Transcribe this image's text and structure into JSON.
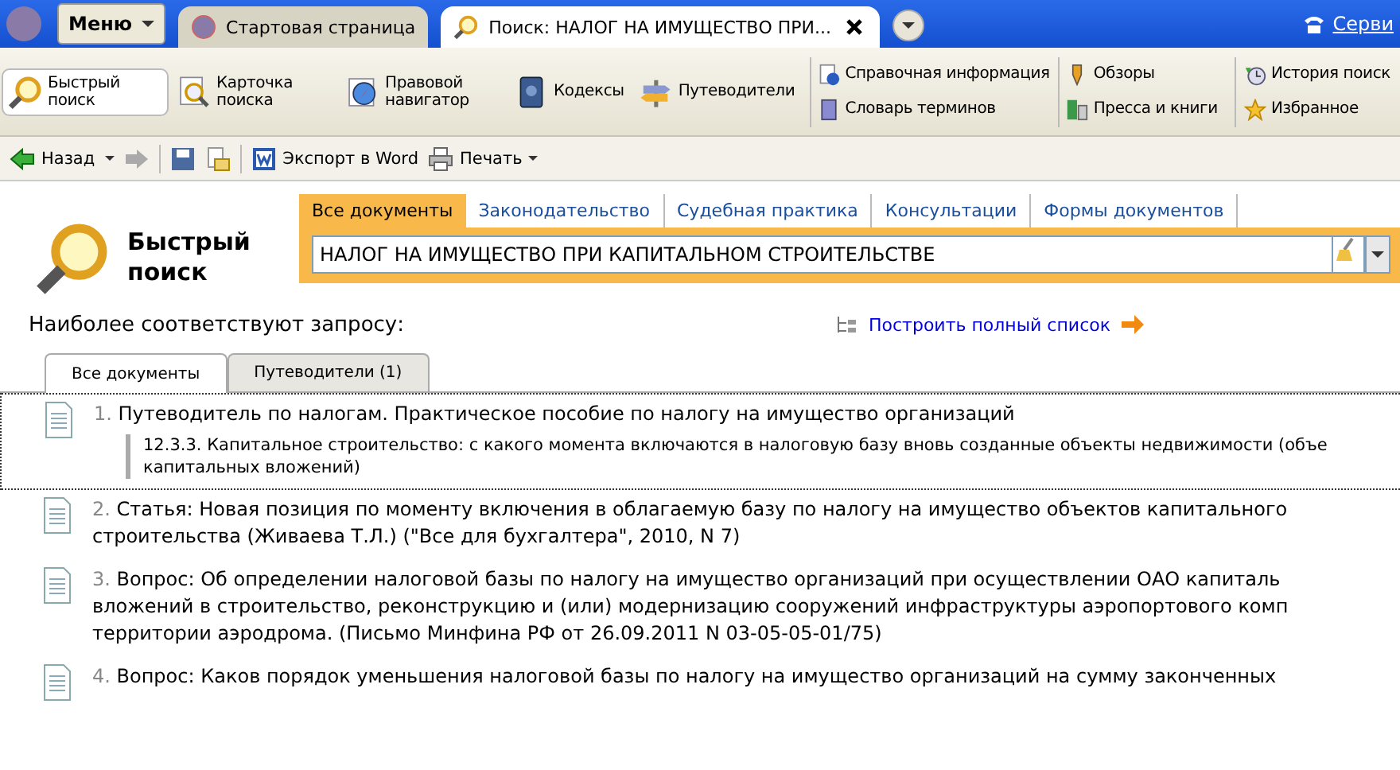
{
  "tabbar": {
    "menu": "Меню",
    "tabs": [
      {
        "label": "Стартовая страница",
        "selected": false
      },
      {
        "label": "Поиск: НАЛОГ НА ИМУЩЕСТВО ПРИ...",
        "selected": true
      }
    ],
    "service": "Серви"
  },
  "toolbar": {
    "big": [
      {
        "label": "Быстрый поиск",
        "selected": true
      },
      {
        "label": "Карточка поиска",
        "selected": false
      },
      {
        "label": "Правовой навигатор",
        "selected": false
      },
      {
        "label": "Кодексы",
        "selected": false
      },
      {
        "label": "Путеводители",
        "selected": false
      }
    ],
    "small_columns": [
      [
        "Справочная информация",
        "Словарь терминов"
      ],
      [
        "Обзоры",
        "Пресса и книги"
      ],
      [
        "История поиск",
        "Избранное"
      ]
    ]
  },
  "nav": {
    "back": "Назад",
    "export": "Экспорт в Word",
    "print": "Печать"
  },
  "search": {
    "title": "Быстрый поиск",
    "tabs": [
      {
        "label": "Все документы",
        "selected": true
      },
      {
        "label": "Законодательство",
        "selected": false
      },
      {
        "label": "Судебная практика",
        "selected": false
      },
      {
        "label": "Консультации",
        "selected": false
      },
      {
        "label": "Формы документов",
        "selected": false
      }
    ],
    "value": "НАЛОГ НА ИМУЩЕСТВО ПРИ КАПИТАЛЬНОМ СТРОИТЕЛЬСТВЕ"
  },
  "results": {
    "heading": "Наиболее соответствуют запросу:",
    "full_list_link": "Построить полный список",
    "tabs": [
      {
        "label": "Все документы",
        "selected": true
      },
      {
        "label": "Путеводители (1)",
        "selected": false
      }
    ],
    "items": [
      {
        "number": "1.",
        "lines": [
          "Путеводитель по налогам. Практическое пособие по налогу на имущество организаций"
        ],
        "focused": true,
        "snippet": [
          "12.3.3. Капитальное строительство: с какого момента включаются в налоговую базу вновь созданные объекты недвижимости (объе",
          "капитальных вложений)"
        ]
      },
      {
        "number": "2.",
        "lines": [
          "Статья: Новая позиция по моменту включения в облагаемую базу по налогу на имущество объектов капитального",
          "строительства (Живаева Т.Л.) (\"Все для бухгалтера\", 2010, N 7)"
        ],
        "focused": false
      },
      {
        "number": "3.",
        "lines": [
          "Вопрос: Об определении налоговой базы по налогу на имущество организаций при осуществлении ОАО капиталь",
          "вложений в строительство, реконструкцию и (или) модернизацию сооружений инфраструктуры аэропортового комп",
          "территории аэродрома. (Письмо Минфина РФ от 26.09.2011 N 03-05-05-01/75)"
        ],
        "focused": false
      },
      {
        "number": "4.",
        "lines": [
          "Вопрос: Каков порядок уменьшения налоговой базы по налогу на имущество организаций на сумму законченных"
        ],
        "focused": false
      }
    ]
  }
}
